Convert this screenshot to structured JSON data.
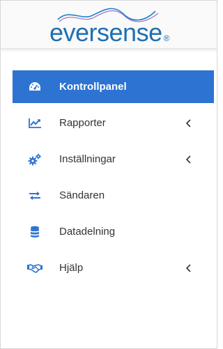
{
  "brand": {
    "name": "eversense",
    "registered_mark": "®",
    "colors": {
      "primary": "#1f6fb2",
      "accent": "#2d73d1",
      "wave": "#8a5cc6"
    }
  },
  "sidebar": {
    "items": [
      {
        "label": "Kontrollpanel",
        "icon": "dashboard-gauge-icon",
        "active": true,
        "has_submenu": false
      },
      {
        "label": "Rapporter",
        "icon": "line-chart-icon",
        "active": false,
        "has_submenu": true
      },
      {
        "label": "Inställningar",
        "icon": "gears-icon",
        "active": false,
        "has_submenu": true
      },
      {
        "label": "Sändaren",
        "icon": "transfer-arrows-icon",
        "active": false,
        "has_submenu": false
      },
      {
        "label": "Datadelning",
        "icon": "database-icon",
        "active": false,
        "has_submenu": false
      },
      {
        "label": "Hjälp",
        "icon": "handshake-icon",
        "active": false,
        "has_submenu": true
      }
    ]
  }
}
